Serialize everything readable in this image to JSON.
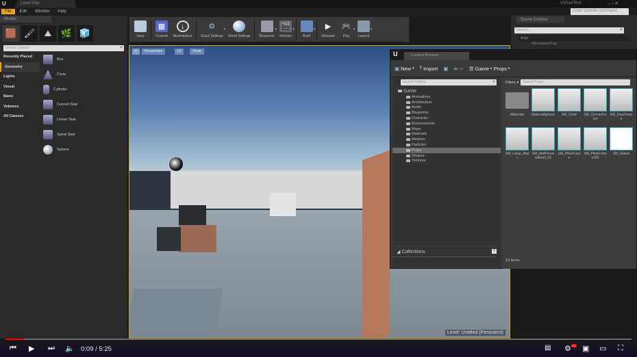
{
  "window": {
    "tab": "Level Map",
    "app_user": "VirtuaTest",
    "search_placeholder": "Enter console command"
  },
  "menu": [
    "File",
    "Edit",
    "Window",
    "Help"
  ],
  "modes": {
    "tab": "Modes",
    "search_placeholder": "Search Classes",
    "categories": [
      "Recently Placed",
      "Geometry",
      "Lights",
      "Visual",
      "Basic",
      "Volumes",
      "All Classes"
    ],
    "items": [
      "Box",
      "Cone",
      "Cylinder",
      "Curved Stair",
      "Linear Stair",
      "Spiral Stair",
      "Sphere"
    ]
  },
  "toolbar": [
    {
      "label": "Save",
      "icon": "save-icon"
    },
    {
      "label": "Content",
      "icon": "content-icon"
    },
    {
      "label": "Marketplace",
      "icon": "marketplace-icon"
    },
    {
      "label": "Quick Settings",
      "icon": "settings-icon"
    },
    {
      "label": "World Settings",
      "icon": "world-icon"
    },
    {
      "label": "Blueprints",
      "icon": "blueprint-icon"
    },
    {
      "label": "Matinee",
      "icon": "clapper-icon"
    },
    {
      "label": "Build",
      "icon": "build-icon"
    },
    {
      "label": "Simulate",
      "icon": "play-icon"
    },
    {
      "label": "Play",
      "icon": "gamepad-icon"
    },
    {
      "label": "Launch",
      "icon": "launch-icon"
    }
  ],
  "viewport": {
    "buttons": [
      "Perspective",
      "Lit",
      "Show"
    ],
    "level_label": "Level: Untitled (Persistent)"
  },
  "content_browser": {
    "tab": "Content Browser",
    "new": "New",
    "import": "Import",
    "breadcrumb": [
      "Game",
      "Props"
    ],
    "search_folders": "Search Folders",
    "filters": "Filters",
    "search_assets": "Search Props",
    "tree_root": "Game",
    "folders": [
      "Animations",
      "Architecture",
      "Audio",
      "Blueprints",
      "Character",
      "Environments",
      "Maps",
      "Materials",
      "Meshes",
      "Particles",
      "Props",
      "Shapes",
      "Textures"
    ],
    "selected_folder": "Props",
    "collections": "Collections",
    "item_count": "14 items",
    "assets": [
      "Materials",
      "MaterialSphere",
      "SM_Chair",
      "SM_CornerFrame",
      "SM_DoorFrame",
      "SM_Lamp_Wall",
      "SM_MatPreviewMesh_02",
      "SM_PillarFrame",
      "SM_PillarFrame300",
      "SM_Statue"
    ]
  },
  "outliner": {
    "tab": "Scene Outliner",
    "search_placeholder": "Search...",
    "column": "Actor",
    "first_row": "AtmosphericFog"
  },
  "player": {
    "time": "0:09 / 5:25",
    "progress": 0.028
  }
}
